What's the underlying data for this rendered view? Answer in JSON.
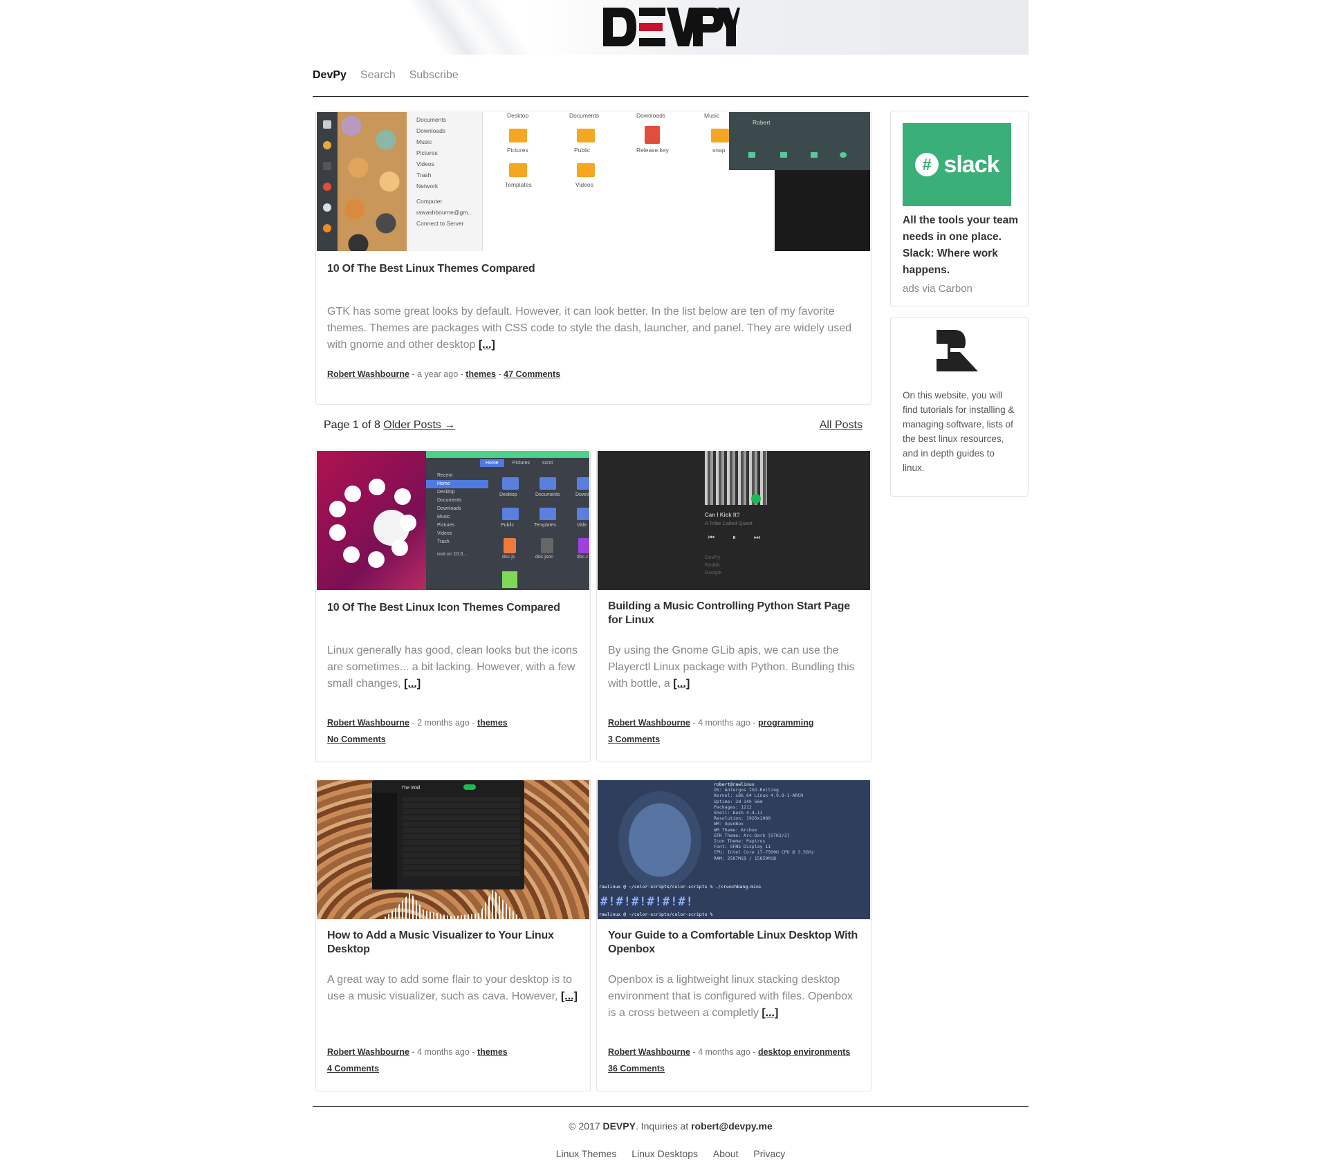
{
  "site": {
    "logo_text": "DEVPY",
    "nav": [
      "DevPy",
      "Search",
      "Subscribe"
    ]
  },
  "featured": {
    "thumb_sidebar": [
      "Documents",
      "Downloads",
      "Music",
      "Pictures",
      "Videos",
      "Trash",
      "Network",
      "Computer",
      "rawashbourne@gm...",
      "Connect to Server"
    ],
    "thumb_folders": [
      "Desktop",
      "Documents",
      "Downloads",
      "Music",
      "Pictures",
      "Public",
      "Release.key",
      "snap",
      "Templates",
      "Videos"
    ],
    "thumb_menu_user": "Robert",
    "title": "10 Of The Best Linux Themes Compared",
    "excerpt": "GTK has some great looks by default. However, it can look better. In the list below are ten of my favorite themes. Themes are packages with CSS code to style the dash, launcher, and panel. They are widely used with gnome and other desktop",
    "more": "[...]",
    "author": "Robert Washbourne",
    "time": "a year ago",
    "tag": "themes",
    "comments": "47 Comments"
  },
  "pager": {
    "page_text": "Page 1 of 8",
    "older": "Older Posts →",
    "all": "All Posts"
  },
  "posts": [
    {
      "title": "10 Of The Best Linux Icon Themes Compared",
      "excerpt": "Linux generally has good, clean looks but the icons are sometimes... a bit lacking. However, with a few small changes,",
      "more": "[...]",
      "author": "Robert Washbourne",
      "time": "2 months ago",
      "tag": "themes",
      "comments": "No Comments",
      "thumb_tabs": [
        "Home",
        "Pictures",
        "scrot"
      ],
      "thumb_sidebar": [
        "Recent",
        "Home",
        "Desktop",
        "Documents",
        "Downloads",
        "Music",
        "Pictures",
        "Videos",
        "Trash",
        "root on 10.0..."
      ],
      "thumb_files": [
        "Desktop",
        "Documents",
        "Downl",
        "Public",
        "Templates",
        "Vide",
        "doc.js",
        "doc.json",
        "doc.c"
      ]
    },
    {
      "title": "Building a Music Controlling Python Start Page for Linux",
      "excerpt": "By using the Gnome GLib apis, we can use the Playerctl Linux package with Python. Bundling this with bottle, a",
      "more": "[...]",
      "author": "Robert Washbourne",
      "time": "4 months ago",
      "tag": "programming",
      "comments": "3 Comments",
      "thumb_song": "Can I Kick It?",
      "thumb_artist": "A Tribe Called Quest",
      "thumb_links": [
        "DevPy",
        "Reddit",
        "Google"
      ]
    },
    {
      "title": "How to Add a Music Visualizer to Your Linux Desktop",
      "excerpt": "A great way to add some flair to your desktop is to use a music visualizer, such as cava. However,",
      "more": "[...]",
      "author": "Robert Washbourne",
      "time": "4 months ago",
      "tag": "themes",
      "comments": "4 Comments",
      "thumb_album": "The Wall"
    },
    {
      "title": "Your Guide to a Comfortable Linux Desktop With Openbox",
      "excerpt": "Openbox is a lightweight linux stacking desktop environment that is configured with files. Openbox is a cross between a completly",
      "more": "[...]",
      "author": "Robert Washbourne",
      "time": "4 months ago",
      "tag": "desktop environments",
      "comments": "36 Comments",
      "thumb_terminal": [
        "robert@rawlinux",
        "OS: Antergos ISO-Rolling",
        "Kernel: x86_64 Linux 4.9.8-1-ARCH",
        "Uptime: 2d 14h 56m",
        "Packages: 1212",
        "Shell: bash 4.4.11",
        "Resolution: 1920x1080",
        "WM: OpenBox",
        "WM Theme: Arcbox",
        "GTK Theme: Arc-Dark [GTK2/3]",
        "Icon Theme: Papirus",
        "Font: SFNS Display 11",
        "CPU: Intel Core i7-7500U CPU @ 3.5GHz",
        "RAM: 2587MiB / 15859MiB"
      ],
      "thumb_prompt1": "rawlinux @ ~/color-scripts/color-scripts % ./crunchbang-mini",
      "thumb_prompt2": "rawlinux @ ~/color-scripts/color-scripts % "
    }
  ],
  "ad": {
    "brand": "slack",
    "text": "All the tools your team needs in one place. Slack: Where work happens.",
    "via": "ads via Carbon"
  },
  "about": {
    "text": "On this website, you will find tutorials for installing & managing software, lists of the best linux resources, and in depth guides to linux."
  },
  "footer": {
    "copy_prefix": "© 2017 ",
    "brand": "DEVPY",
    "inquiries": ". Inquiries at ",
    "email": "robert@devpy.me",
    "links": [
      "Linux Themes",
      "Linux Desktops",
      "About",
      "Privacy"
    ]
  },
  "colors": {
    "slack_green": "#3aaf77",
    "text": "#333333",
    "muted": "#888888"
  }
}
